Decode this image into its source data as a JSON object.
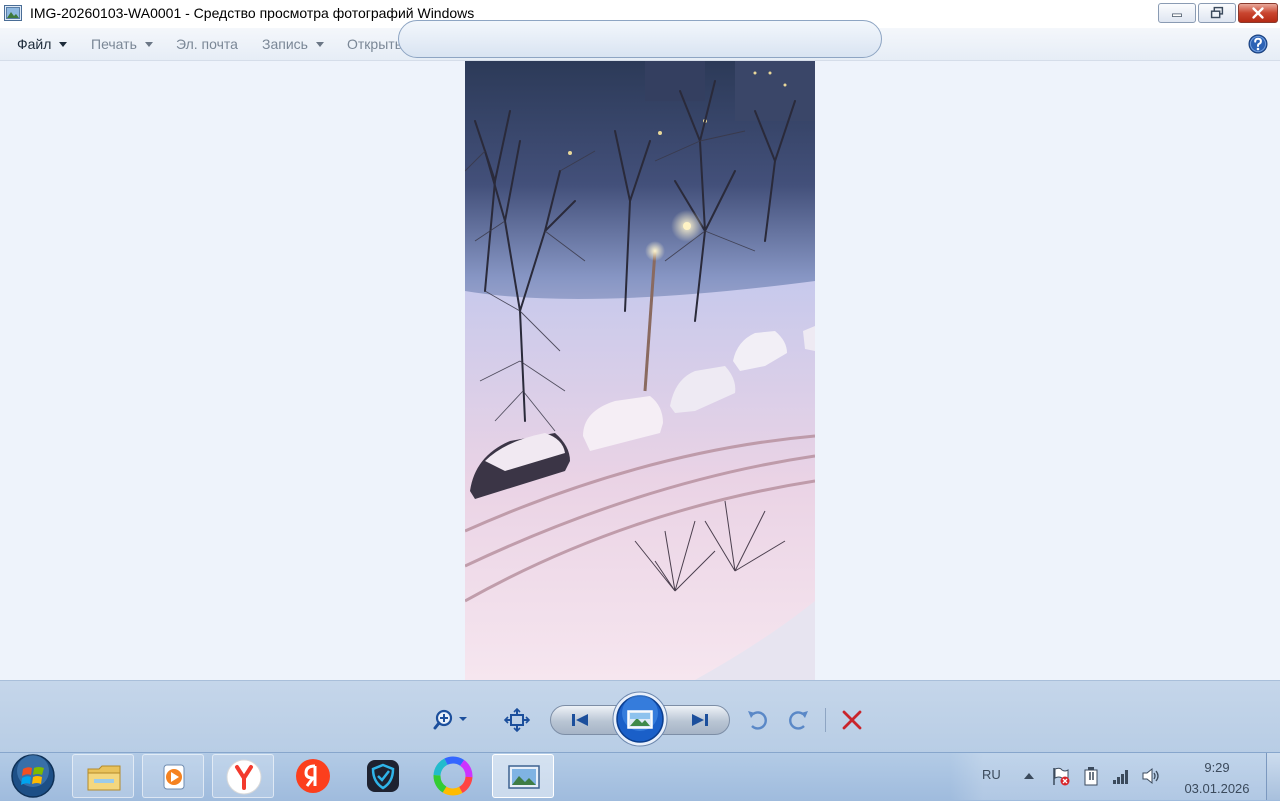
{
  "window": {
    "title": "IMG-20260103-WA0001 - Средство просмотра фотографий Windows",
    "buttons": {
      "minimize": "minimize-icon",
      "restore": "restore-icon",
      "close": "close-icon"
    }
  },
  "menu": {
    "items": [
      {
        "label": "Файл",
        "has_dropdown": true,
        "enabled": true
      },
      {
        "label": "Печать",
        "has_dropdown": true,
        "enabled": false
      },
      {
        "label": "Эл. почта",
        "has_dropdown": false,
        "enabled": false
      },
      {
        "label": "Запись",
        "has_dropdown": true,
        "enabled": false
      },
      {
        "label": "Открыть",
        "has_dropdown": true,
        "enabled": false
      }
    ],
    "help_icon": "help-icon"
  },
  "viewer": {
    "image_content": "snowy-courtyard-photo",
    "background": "#eef3fb"
  },
  "controls": {
    "icons": [
      "zoom-icon",
      "actual-size-icon",
      "previous-icon",
      "slideshow-icon",
      "next-icon",
      "rotate-left-icon",
      "rotate-right-icon",
      "delete-icon"
    ],
    "delete_color": "#c9242b"
  },
  "taskbar": {
    "start_icon": "windows-start-icon",
    "apps": [
      "file-explorer-icon",
      "media-player-icon",
      "yandex-browser-icon",
      "yandex-icon",
      "shield-icon",
      "color-wheel-icon",
      "photo-viewer-icon"
    ],
    "tray": {
      "language": "RU",
      "icons": [
        "show-hidden-icons-arrow",
        "action-center-flag-icon",
        "power-icon",
        "network-signal-icon",
        "volume-icon"
      ]
    },
    "clock": {
      "time": "9:29",
      "date": "03.01.2026"
    }
  }
}
